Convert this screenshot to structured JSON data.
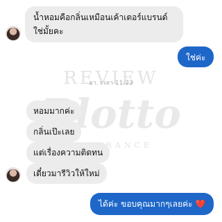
{
  "messages": [
    {
      "from": "customer",
      "text": "น้ำหอมคือกลิ่นเหมือนเค้าเตอร์แบรนด์ใช่มั้ยคะ"
    },
    {
      "from": "shop",
      "text": "ใช่ค่ะ"
    },
    {
      "from": "customer",
      "text": "หอมมากค่ะ"
    },
    {
      "from": "customer",
      "text": "กลิ่นเป๊ะเลย"
    },
    {
      "from": "customer",
      "text": "แต่เรื่องความติดทน"
    },
    {
      "from": "customer",
      "text": "เดี๋ยวมารีวิวให้ใหม่"
    },
    {
      "from": "shop",
      "text": "ได้ค่ะ ขอบคุณมากๆเลยค่ะ",
      "emoji": "❤️"
    }
  ],
  "timestamp": "อา. เวลา 11:23",
  "watermark": {
    "top": "REVIEW",
    "logo": "Blotto",
    "bottom": "FRAGRANCE"
  },
  "colors": {
    "outgoing_bubble": "#1e67c9",
    "incoming_bubble": "#ececec",
    "background": "#ffffff"
  }
}
